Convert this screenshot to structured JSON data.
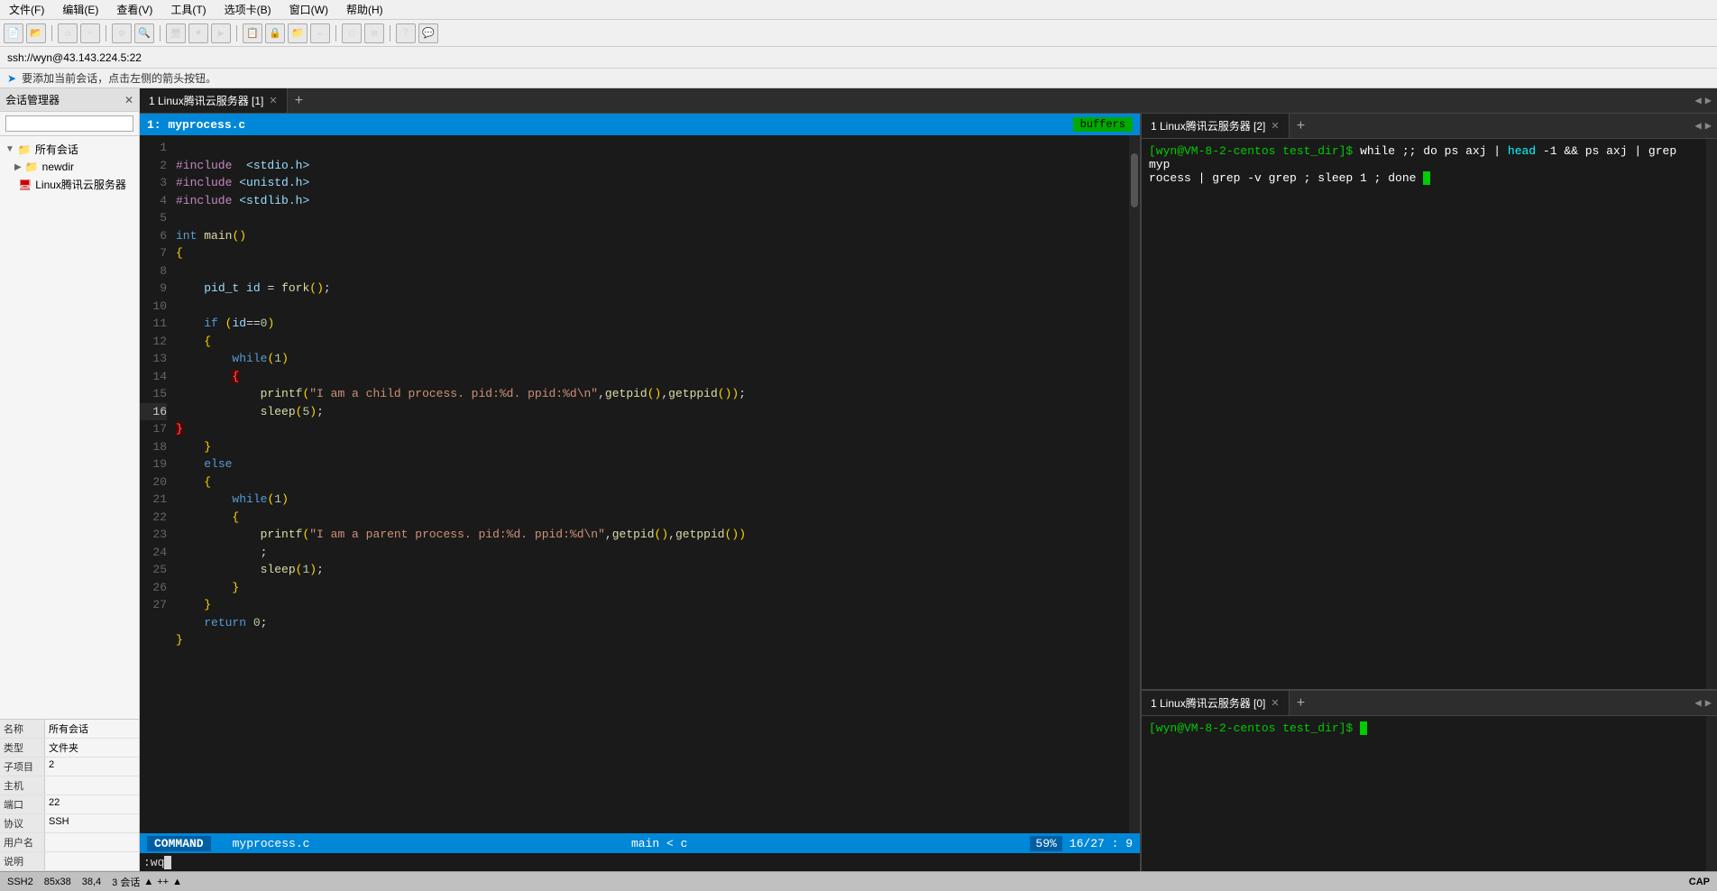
{
  "window": {
    "title": "ssh://wyn@43.143.224.5:22"
  },
  "menubar": {
    "items": [
      "文件(F)",
      "编辑(E)",
      "查看(V)",
      "工具(T)",
      "选项卡(B)",
      "窗口(W)",
      "帮助(H)"
    ]
  },
  "infobar": {
    "text": "要添加当前会话，点击左侧的箭头按钮。"
  },
  "addressbar": {
    "text": "ssh://wyn@43.143.224.5:22"
  },
  "sidebar": {
    "header": "会话管理器",
    "search_placeholder": "",
    "tree": [
      {
        "label": "所有会话",
        "level": 0,
        "type": "root",
        "expanded": true
      },
      {
        "label": "newdir",
        "level": 1,
        "type": "folder"
      },
      {
        "label": "Linux腾讯云服务器",
        "level": 1,
        "type": "server"
      }
    ],
    "props": [
      {
        "label": "名称",
        "value": "所有会话"
      },
      {
        "label": "类型",
        "value": "文件夹"
      },
      {
        "label": "子项目",
        "value": "2"
      },
      {
        "label": "主机",
        "value": ""
      },
      {
        "label": "端口",
        "value": "22"
      },
      {
        "label": "协议",
        "value": "SSH"
      },
      {
        "label": "用户名",
        "value": ""
      },
      {
        "label": "说明",
        "value": ""
      }
    ]
  },
  "editor": {
    "tab_label": "1 Linux腾讯云服务器 [1]",
    "filename": "1: myprocess.c",
    "buffers_label": "buffers",
    "code_lines": [
      {
        "num": 1,
        "code": "#include  <stdio.h>"
      },
      {
        "num": 2,
        "code": "#include <unistd.h>"
      },
      {
        "num": 3,
        "code": "#include <stdlib.h>"
      },
      {
        "num": 4,
        "code": ""
      },
      {
        "num": 5,
        "code": "int main()"
      },
      {
        "num": 6,
        "code": "{"
      },
      {
        "num": 7,
        "code": ""
      },
      {
        "num": 8,
        "code": "    pid_t id = fork();"
      },
      {
        "num": 9,
        "code": ""
      },
      {
        "num": 10,
        "code": "    if (id==0)"
      },
      {
        "num": 11,
        "code": "    {"
      },
      {
        "num": 12,
        "code": "        while(1)"
      },
      {
        "num": 13,
        "code": "        {"
      },
      {
        "num": 14,
        "code": "            printf(\"I am a child process. pid:%d. ppid:%d\\n\",getpid(),getppid());"
      },
      {
        "num": 15,
        "code": "            sleep(5);"
      },
      {
        "num": 16,
        "code": "        }"
      },
      {
        "num": 17,
        "code": "    }"
      },
      {
        "num": 18,
        "code": "    else"
      },
      {
        "num": 19,
        "code": "    {"
      },
      {
        "num": 20,
        "code": "        while(1)"
      },
      {
        "num": 21,
        "code": "        {"
      },
      {
        "num": 22,
        "code": "            printf(\"I am a parent process. pid:%d. ppid:%d\\n\",getpid(),getppid())"
      },
      {
        "num": 23,
        "code": "            ;"
      },
      {
        "num": 23,
        "code": "            sleep(1);"
      },
      {
        "num": 24,
        "code": "        }"
      },
      {
        "num": 25,
        "code": "    }"
      },
      {
        "num": 26,
        "code": "    return 0;"
      },
      {
        "num": 27,
        "code": "}"
      }
    ],
    "vim_mode": "COMMAND",
    "vim_filename": "myprocess.c",
    "vim_func": "main < c",
    "vim_pct": "59%",
    "vim_linepos": "16/27 :  9",
    "vim_cmdline": ":wq"
  },
  "terminal1": {
    "tab_label": "1 Linux腾讯云服务器 [2]",
    "prompt": "[wyn@VM-8-2-centos test_dir]$",
    "command": " while ;; do ps axj | head -1 && ps axj | grep myprocess | grep -v grep ; sleep 1 ; done",
    "output": ""
  },
  "terminal2": {
    "tab_label": "1 Linux腾讯云服务器 [0]",
    "prompt": "[wyn@VM-8-2-centos test_dir]$",
    "cursor": " "
  },
  "statusbar": {
    "ssh_label": "SSH2",
    "dimensions": "85x38",
    "position": "38,4",
    "sessions": "3 会话",
    "cap_label": "CAP",
    "indicators": "▲ ++ ▲"
  }
}
